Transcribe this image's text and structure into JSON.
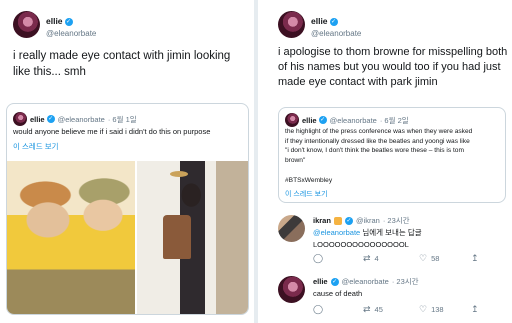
{
  "left": {
    "author": {
      "name": "ellie",
      "handle": "@eleanorbate"
    },
    "text": "i really made eye contact with jimin looking like this... smh",
    "quote": {
      "author": {
        "name": "ellie",
        "handle": "@eleanorbate"
      },
      "meta": "· 6월 1일",
      "text": "would anyone believe me if i said i didn't do this on purpose",
      "thread_link": "이 스레드 보기"
    }
  },
  "right": {
    "author": {
      "name": "ellie",
      "handle": "@eleanorbate"
    },
    "text": "i apologise to thom browne for misspelling both of his names but you would too if you had just made eye contact with park jimin",
    "quote": {
      "author": {
        "name": "ellie",
        "handle": "@eleanorbate"
      },
      "meta": "· 6월 2일",
      "lines": [
        "the highlight of the press conference was when they were asked",
        "if they intentionally dressed like the beatles and yoongi was like",
        "\"i don't know, I don't think the beatles wore these – this is tom",
        "brown\""
      ],
      "hashtag": "#BTSxWembley",
      "thread_link": "이 스레드 보기"
    },
    "replies": [
      {
        "name": "ikran",
        "handle": "@ikran",
        "time": "· 23시간",
        "mention": "@eleanorbate",
        "mention_suffix": " 님에게 보내는 답글",
        "text": "LOOOOOOOOOOOOOOOL",
        "reply_count": "",
        "retweets": "4",
        "likes": "58"
      },
      {
        "name": "ellie",
        "handle": "@eleanorbate",
        "time": "· 23시간",
        "text": "cause of death",
        "reply_count": "",
        "retweets": "45",
        "likes": "138"
      }
    ]
  },
  "icons": {
    "verified": "✓",
    "reply": "◯",
    "retweet": "⇄",
    "like": "♡",
    "share": "↥"
  }
}
